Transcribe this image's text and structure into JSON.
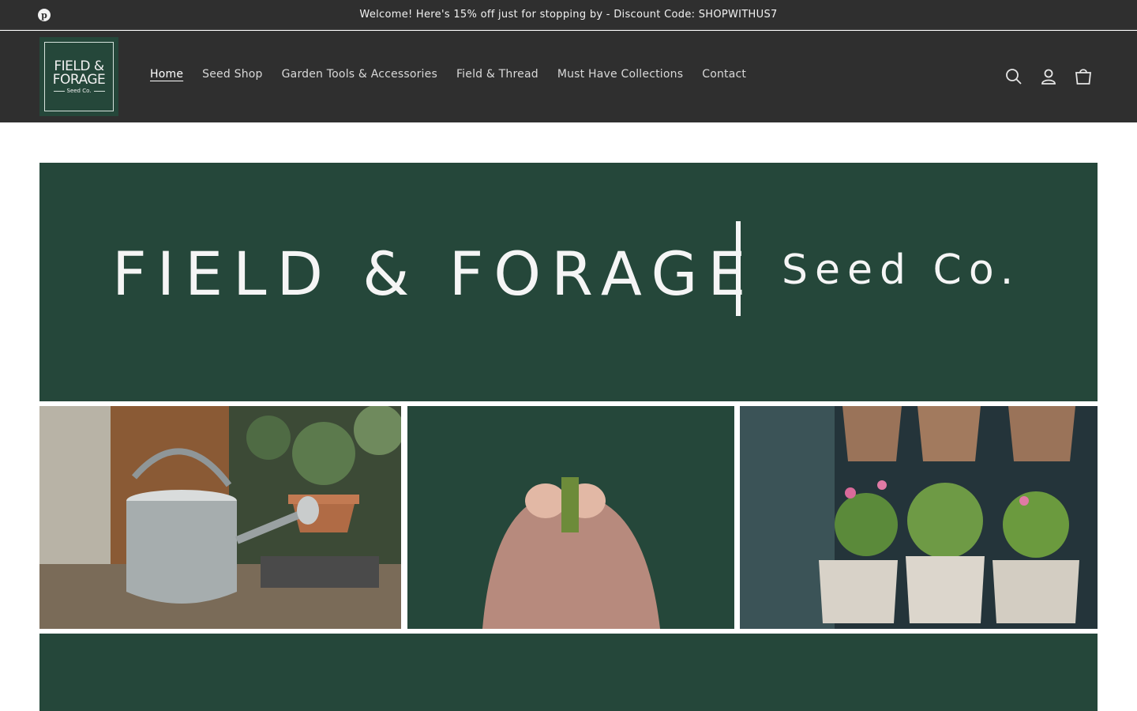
{
  "announcement": {
    "text": "Welcome! Here's 15% off just for stopping by - Discount Code: SHOPWITHUS7",
    "social_icon": "pinterest-icon"
  },
  "header": {
    "logo": {
      "line1": "FIELD &",
      "line2": "FORAGE",
      "line3": "Seed Co."
    },
    "nav": [
      {
        "label": "Home",
        "active": true
      },
      {
        "label": "Seed Shop"
      },
      {
        "label": "Garden Tools & Accessories"
      },
      {
        "label": "Field & Thread"
      },
      {
        "label": "Must Have Collections"
      },
      {
        "label": "Contact"
      }
    ],
    "icons": [
      "search-icon",
      "account-icon",
      "cart-icon"
    ]
  },
  "hero": {
    "title": "FIELD & FORAGE",
    "subtitle": "Seed Co.",
    "brand_color": "#25473a"
  },
  "colors": {
    "header_bg": "#2f2f2f",
    "brand_green": "#25473a",
    "text_light": "#f2f2f2"
  }
}
